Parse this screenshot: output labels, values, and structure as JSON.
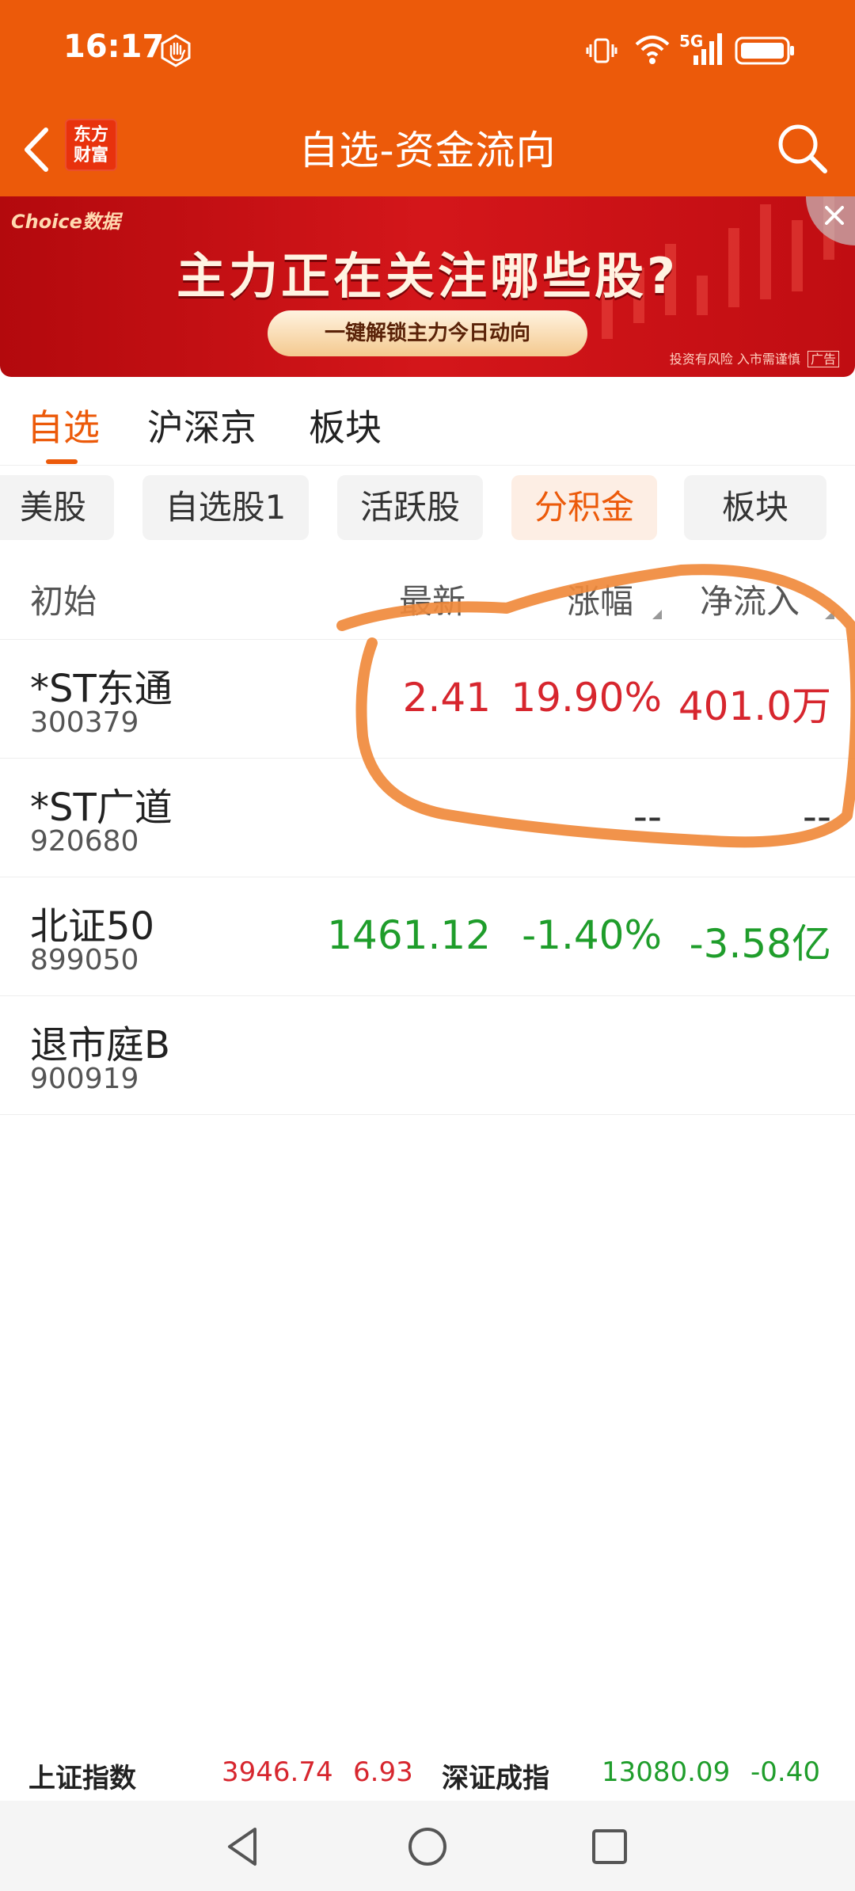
{
  "status": {
    "time": "16:17",
    "network": "5G"
  },
  "header": {
    "title": "自选-资金流向",
    "logo_line1": "东方",
    "logo_line2": "财富"
  },
  "banner": {
    "brand": "Choice数据",
    "headline": "主力正在关注哪些股?",
    "cta": "一键解锁主力今日动向",
    "risk": "投资有风险 入市需谨慎",
    "ad_tag": "广告"
  },
  "tabs": [
    {
      "label": "自选",
      "active": true
    },
    {
      "label": "沪深京",
      "active": false
    },
    {
      "label": "板块",
      "active": false
    }
  ],
  "chips": [
    {
      "label": "美股",
      "active": false
    },
    {
      "label": "自选股1",
      "active": false
    },
    {
      "label": "活跃股",
      "active": false
    },
    {
      "label": "分积金",
      "active": true
    },
    {
      "label": "板块",
      "active": false
    }
  ],
  "table": {
    "columns": [
      "初始",
      "最新",
      "涨幅",
      "净流入"
    ],
    "rows": [
      {
        "name": "*ST东通",
        "code": "300379",
        "latest": "2.41",
        "change": "19.90%",
        "inflow": "401.0万",
        "tone": "red"
      },
      {
        "name": "*ST广道",
        "code": "920680",
        "latest": "",
        "change": "--",
        "inflow": "--",
        "tone": "dash"
      },
      {
        "name": "北证50",
        "code": "899050",
        "latest": "1461.12",
        "change": "-1.40%",
        "inflow": "-3.58亿",
        "tone": "green"
      },
      {
        "name": "退市庭B",
        "code": "900919",
        "latest": "",
        "change": "",
        "inflow": "",
        "tone": "dash"
      }
    ]
  },
  "ticker": {
    "sh_label": "上证指数",
    "sh_value": "3946.74",
    "sh_change": "6.93",
    "sz_label": "深证成指",
    "sz_value": "13080.09",
    "sz_change": "-0.40"
  },
  "colors": {
    "brand_orange": "#ec5a0a",
    "rise_red": "#d7262e",
    "fall_green": "#1f9d2b",
    "annotation": "#f08a3c"
  }
}
